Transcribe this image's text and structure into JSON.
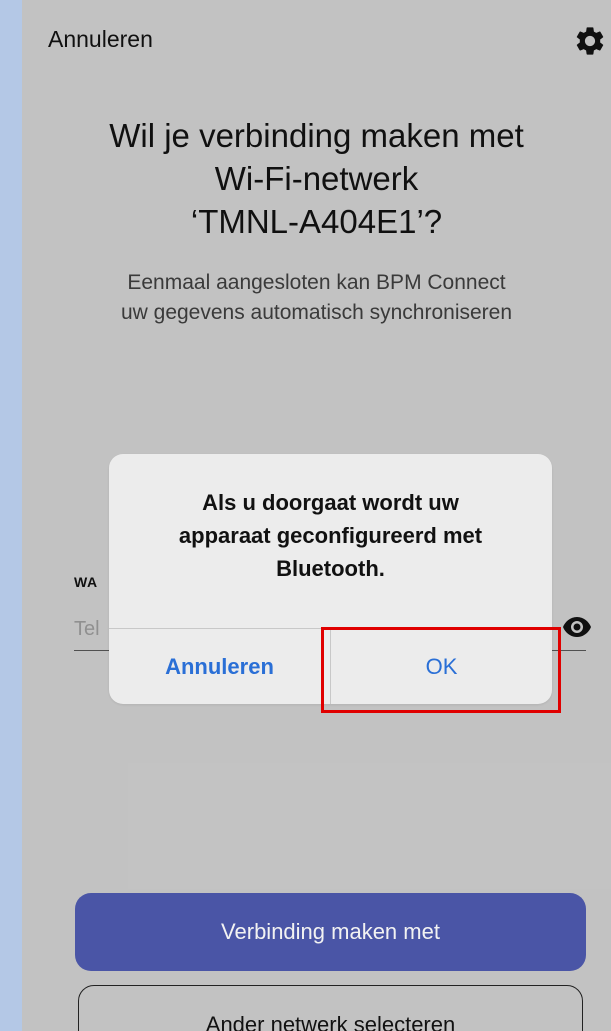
{
  "topbar": {
    "cancel_label": "Annuleren",
    "settings_icon": "gear-icon"
  },
  "heading": {
    "line1": "Wil je verbinding maken met",
    "line2": "Wi-Fi-netwerk",
    "line3": "‘TMNL-A404E1’?"
  },
  "subtitle": {
    "line1": "Eenmaal aangesloten kan BPM Connect",
    "line2": "uw gegevens automatisch synchroniseren"
  },
  "password_field": {
    "label": "WA",
    "placeholder": "Tel",
    "visibility_icon": "eye-icon"
  },
  "dialog": {
    "message_line1": "Als u doorgaat wordt uw",
    "message_line2": "apparaat geconfigureerd met",
    "message_line3": "Bluetooth.",
    "cancel_label": "Annuleren",
    "ok_label": "OK"
  },
  "highlight_color": "#e00000",
  "buttons": {
    "primary_label": "Verbinding maken met",
    "secondary_label": "Ander netwerk selecteren"
  },
  "colors": {
    "primary_button": "#4a55a6",
    "dialog_action": "#2a6fd6",
    "background": "#cfcfcf"
  }
}
